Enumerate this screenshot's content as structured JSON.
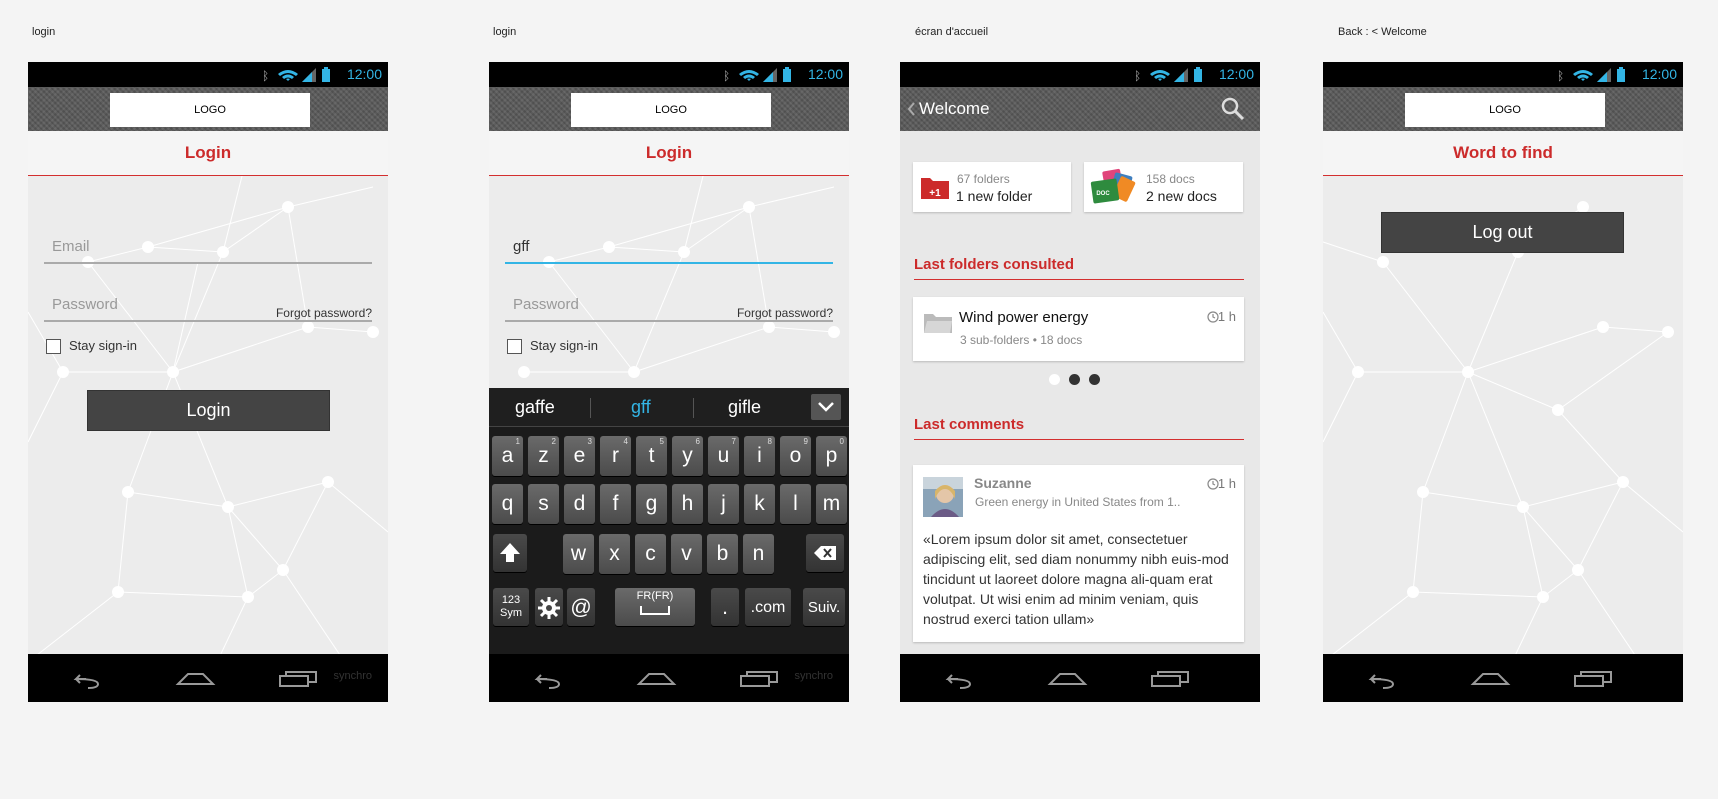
{
  "captions": [
    "login",
    "login",
    "écran d'accueil",
    "Back : < Welcome"
  ],
  "status": {
    "time": "12:00"
  },
  "logo": "LOGO",
  "login1": {
    "title": "Login",
    "email_placeholder": "Email",
    "password_placeholder": "Password",
    "forgot": "Forgot password?",
    "stay": "Stay sign-in",
    "button": "Login",
    "ghost": "synchro"
  },
  "login2": {
    "title": "Login",
    "email_value": "gff",
    "password_placeholder": "Password",
    "forgot": "Forgot password?",
    "stay": "Stay sign-in",
    "ghost": "synchro",
    "suggestions": [
      "gaffe",
      "gff",
      "gifle"
    ],
    "row1": [
      [
        "a",
        "1"
      ],
      [
        "z",
        "2"
      ],
      [
        "e",
        "3"
      ],
      [
        "r",
        "4"
      ],
      [
        "t",
        "5"
      ],
      [
        "y",
        "6"
      ],
      [
        "u",
        "7"
      ],
      [
        "i",
        "8"
      ],
      [
        "o",
        "9"
      ],
      [
        "p",
        "0"
      ]
    ],
    "row2": [
      "q",
      "s",
      "d",
      "f",
      "g",
      "h",
      "j",
      "k",
      "l",
      "m"
    ],
    "row3": [
      "w",
      "x",
      "c",
      "v",
      "b",
      "n"
    ],
    "key_sym": "123\nSym",
    "key_at": "@",
    "key_space": "FR(FR)",
    "key_dot": ".",
    "key_com": ".com",
    "key_next": "Suiv."
  },
  "welcome": {
    "title": "Welcome",
    "folders_count": "67 folders",
    "folders_new": "1 new folder",
    "folders_badge": "+1",
    "docs_count": "158 docs",
    "docs_new": "2 new docs",
    "section_folders": "Last folders consulted",
    "folder_name": "Wind power energy",
    "folder_meta": "3 sub-folders • 18 docs",
    "folder_time": "1 h",
    "section_comments": "Last comments",
    "comment_author": "Suzanne",
    "comment_subject": "Green energy in United States from 1..",
    "comment_time": "1 h",
    "comment_text": "«Lorem ipsum dolor sit amet, consectetuer adipiscing elit, sed diam nonummy nibh euis-mod tincidunt ut laoreet dolore magna ali-quam erat volutpat. Ut wisi enim ad minim veniam, quis nostrud exerci tation ullam»"
  },
  "back": {
    "title": "Word to find",
    "button": "Log out"
  },
  "colors": {
    "accent": "#cc2b2b",
    "blue": "#33b5e5",
    "button": "#444444"
  }
}
